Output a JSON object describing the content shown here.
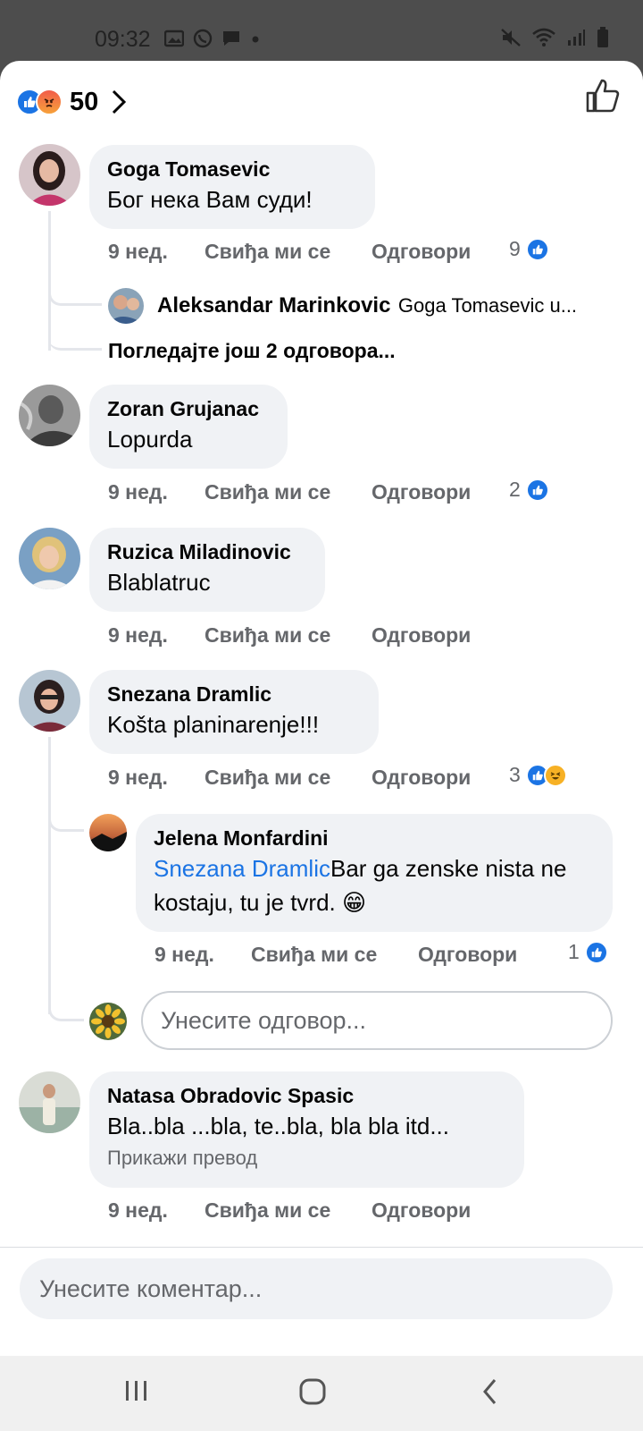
{
  "status_bar": {
    "time": "09:32"
  },
  "header": {
    "reaction_count": "50"
  },
  "comments": [
    {
      "author": "Goga Tomasevic",
      "text": "Бог нека Вам суди!",
      "time": "9 нед.",
      "like": "Свиђа ми се",
      "reply": "Одговори",
      "reactions": "9",
      "reply_preview": {
        "author": "Aleksandar Marinkovic",
        "text": "Goga Tomasevic  u..."
      },
      "more_replies": "Погледајте још 2 одговора..."
    },
    {
      "author": "Zoran Grujanac",
      "text": "Lopurda",
      "time": "9 нед.",
      "like": "Свиђа ми се",
      "reply": "Одговори",
      "reactions": "2"
    },
    {
      "author": "Ruzica Miladinovic",
      "text": "Blablatruc",
      "time": "9 нед.",
      "like": "Свиђа ми се",
      "reply": "Одговори"
    },
    {
      "author": "Snezana Dramlic",
      "text": "Košta planinarenje!!!",
      "time": "9 нед.",
      "like": "Свиђа ми се",
      "reply": "Одговори",
      "reactions": "3",
      "nested": {
        "author": "Jelena Monfardini",
        "mention": "Snezana Dramlic",
        "text": "Bar ga zenske nista ne kostaju, tu je tvrd. 😁",
        "time": "9 нед.",
        "like": "Свиђа ми се",
        "reply": "Одговори",
        "reactions": "1"
      }
    },
    {
      "author": "Natasa Obradovic Spasic",
      "text": "Bla..bla ...bla, te..bla, bla bla itd...",
      "translate": "Прикажи превод",
      "time": "9 нед.",
      "like": "Свиђа ми се",
      "reply": "Одговори"
    }
  ],
  "reply_input": {
    "placeholder": "Унесите одговор..."
  },
  "comment_input": {
    "placeholder": "Унесите коментар..."
  },
  "colors": {
    "accent": "#1b74e4",
    "bubble": "#f0f2f5",
    "meta": "#65676b"
  }
}
